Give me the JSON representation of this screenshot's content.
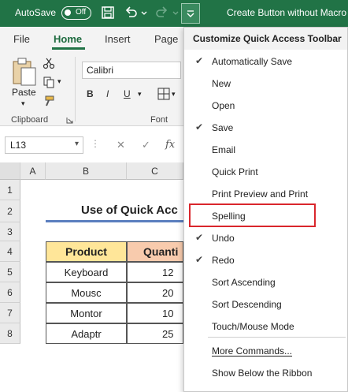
{
  "titlebar": {
    "autosave_label": "AutoSave",
    "autosave_state": "Off",
    "title": "Create Button without Macro"
  },
  "tabs": [
    "File",
    "Home",
    "Insert",
    "Page"
  ],
  "ribbon": {
    "paste_label": "Paste",
    "font_name": "Calibri",
    "bold": "B",
    "italic": "I",
    "underline": "U",
    "clipboard_label": "Clipboard",
    "font_group_label": "Font"
  },
  "formula_bar": {
    "name_box": "L13",
    "cancel": "✕",
    "enter": "✓",
    "fx": "fx"
  },
  "sheet": {
    "columns": [
      "A",
      "B",
      "C"
    ],
    "rows": [
      "1",
      "2",
      "3",
      "4",
      "5",
      "6",
      "7",
      "8"
    ],
    "heading": "Use of Quick Acc",
    "table_headers": [
      "Product",
      "Quanti"
    ],
    "table_rows": [
      [
        "Keyboard",
        "12"
      ],
      [
        "Mousc",
        "20"
      ],
      [
        "Montor",
        "10"
      ],
      [
        "Adaptr",
        "25"
      ]
    ]
  },
  "menu": {
    "header": "Customize Quick Access Toolbar",
    "items": [
      {
        "label": "Automatically Save",
        "checked": "✔"
      },
      {
        "label": "New",
        "checked": ""
      },
      {
        "label": "Open",
        "checked": ""
      },
      {
        "label": "Save",
        "checked": "✔"
      },
      {
        "label": "Email",
        "checked": ""
      },
      {
        "label": "Quick Print",
        "checked": ""
      },
      {
        "label": "Print Preview and Print",
        "checked": ""
      },
      {
        "label": "Spelling",
        "checked": ""
      },
      {
        "label": "Undo",
        "checked": "✔"
      },
      {
        "label": "Redo",
        "checked": "✔"
      },
      {
        "label": "Sort Ascending",
        "checked": ""
      },
      {
        "label": "Sort Descending",
        "checked": ""
      },
      {
        "label": "Touch/Mouse Mode",
        "checked": ""
      },
      {
        "label": "More Commands...",
        "checked": ""
      },
      {
        "label": "Show Below the Ribbon",
        "checked": ""
      }
    ]
  },
  "colors": {
    "excel_green": "#217346",
    "table_header_fill": "#ffe699",
    "table_header_fill_2": "#f8cbad",
    "highlight_red": "#d9262c",
    "heading_underline": "#5b7fbf"
  }
}
